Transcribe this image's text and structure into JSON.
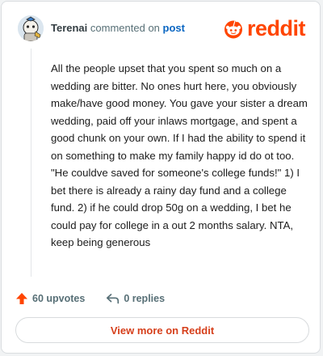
{
  "header": {
    "username": "Terenai",
    "commented_on_text": "commented on",
    "post_link_text": "post"
  },
  "brand": {
    "logo_text": "reddit",
    "icon": "reddit-alien-icon",
    "color": "#ff4500"
  },
  "comment": {
    "text": "All the people upset that you spent so much on a wedding are bitter. No ones hurt here, you obviously make/have good money. You gave your sister a dream wedding, paid off your inlaws mortgage, and spent a good chunk on your own. If I had the ability to spend it on something to make my family happy id do ot too. \"He couldve saved for someone's college funds!\" 1) I bet there is already a rainy day fund and a college fund. 2) if he could drop 50g on a wedding, I bet he could pay for college in a out 2 months salary. NTA, keep being generous"
  },
  "actions": {
    "upvotes_label": "60 upvotes",
    "upvote_icon": "upvote-arrow-icon",
    "replies_label": "0 replies",
    "reply_icon": "reply-arrow-icon"
  },
  "footer": {
    "view_more_label": "View more on Reddit"
  },
  "colors": {
    "accent": "#ff4500",
    "link": "#0a66c2",
    "muted": "#576f76",
    "cta_text": "#d63f1b"
  }
}
